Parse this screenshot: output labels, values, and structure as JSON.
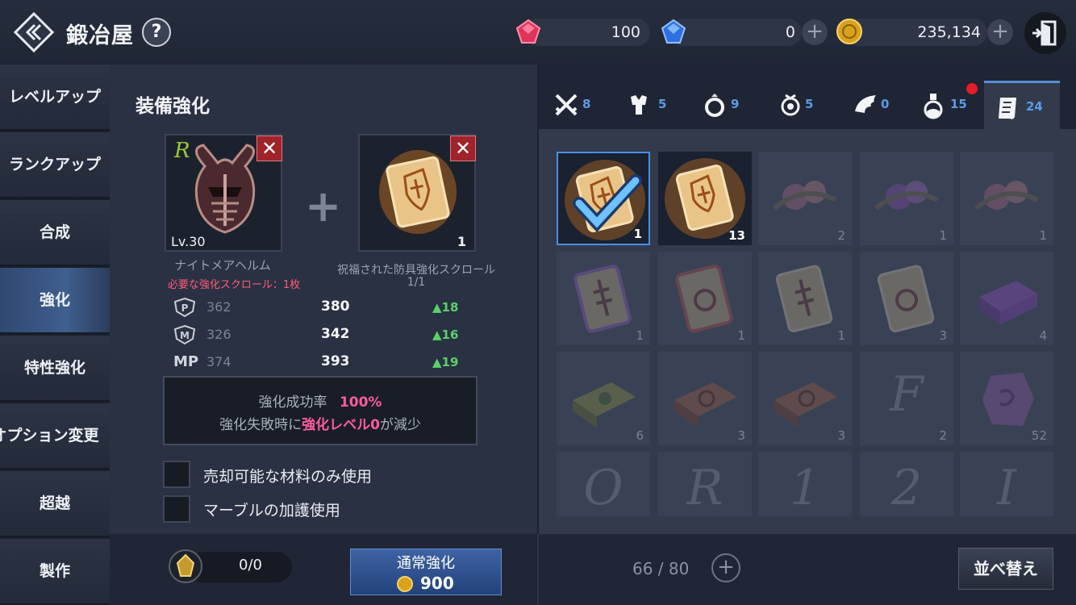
{
  "header": {
    "title": "鍛冶屋",
    "help": "?",
    "currencies": [
      {
        "icon": "red-gem-icon",
        "value": "100"
      },
      {
        "icon": "blue-gem-icon",
        "value": "0"
      },
      {
        "icon": "gold-coin-icon",
        "value": "235,134"
      }
    ]
  },
  "sidebar": {
    "items": [
      {
        "label": "レベルアップ",
        "active": false
      },
      {
        "label": "ランクアップ",
        "active": false
      },
      {
        "label": "合成",
        "active": false
      },
      {
        "label": "強化",
        "active": true
      },
      {
        "label": "特性強化",
        "active": false
      },
      {
        "label": "オプション変更",
        "active": false
      },
      {
        "label": "超越",
        "active": false
      },
      {
        "label": "製作",
        "active": false
      }
    ]
  },
  "enhance": {
    "title": "装備強化",
    "equipment": {
      "rank": "R",
      "level": "Lv.30",
      "name": "ナイトメアヘルム"
    },
    "required_note": "必要な強化スクロール：1枚",
    "material": {
      "count": "1",
      "name": "祝福された防具強化スクロール",
      "ratio": "1/1"
    },
    "stats": [
      {
        "icon": "physical-defense-icon",
        "old": "362",
        "new": "380",
        "diff": "▲18"
      },
      {
        "icon": "magic-defense-icon",
        "old": "326",
        "new": "342",
        "diff": "▲16"
      },
      {
        "label": "MP",
        "old": "374",
        "new": "393",
        "diff": "▲19"
      }
    ],
    "info": {
      "rate_label": "強化成功率",
      "rate_value": "100%",
      "fail_prefix": "強化失敗時に",
      "fail_highlight": "強化レベル0",
      "fail_suffix": "が減少"
    },
    "options": [
      {
        "label": "売却可能な材料のみ使用",
        "checked": false
      },
      {
        "label": "マーブルの加護使用",
        "checked": false
      }
    ]
  },
  "tabs": [
    {
      "icon": "crossed-swords-icon",
      "count": "8"
    },
    {
      "icon": "armor-icon",
      "count": "5"
    },
    {
      "icon": "ring-icon",
      "count": "9"
    },
    {
      "icon": "amulet-icon",
      "count": "5"
    },
    {
      "icon": "wing-icon",
      "count": "0"
    },
    {
      "icon": "potion-icon",
      "count": "15"
    },
    {
      "icon": "scroll-icon",
      "count": "24",
      "active": true
    }
  ],
  "inventory": [
    {
      "kind": "gold-scroll",
      "qty": "1",
      "state": "selected"
    },
    {
      "kind": "gold-scroll",
      "qty": "13",
      "state": "owned"
    },
    {
      "kind": "flower",
      "qty": "2",
      "state": "dim"
    },
    {
      "kind": "flower-purple",
      "qty": "1",
      "state": "dim"
    },
    {
      "kind": "flower",
      "qty": "1",
      "state": "dim"
    },
    {
      "kind": "rune-scroll-purple",
      "qty": "1",
      "state": "dim"
    },
    {
      "kind": "ring-scroll-red",
      "qty": "1",
      "state": "dim"
    },
    {
      "kind": "rune-scroll",
      "qty": "1",
      "state": "dim"
    },
    {
      "kind": "ring-scroll",
      "qty": "3",
      "state": "dim"
    },
    {
      "kind": "purple-box",
      "qty": "4",
      "state": "dim"
    },
    {
      "kind": "green-tablet",
      "qty": "6",
      "state": "dim"
    },
    {
      "kind": "red-tablet",
      "qty": "3",
      "state": "dim"
    },
    {
      "kind": "red-tablet",
      "qty": "3",
      "state": "dim"
    },
    {
      "kind": "letter",
      "letter": "F",
      "qty": "2",
      "state": "dim"
    },
    {
      "kind": "stone-purple",
      "qty": "52",
      "state": "dim"
    },
    {
      "kind": "letter",
      "letter": "O",
      "qty": "",
      "state": "dim"
    },
    {
      "kind": "letter",
      "letter": "R",
      "qty": "",
      "state": "dim"
    },
    {
      "kind": "letter",
      "letter": "1",
      "qty": "",
      "state": "dim"
    },
    {
      "kind": "letter",
      "letter": "2",
      "qty": "",
      "state": "dim"
    },
    {
      "kind": "letter",
      "letter": "I",
      "qty": "",
      "state": "dim"
    }
  ],
  "footer": {
    "stone_count": "0/0",
    "enhance_button": "通常強化",
    "enhance_cost": "900",
    "capacity": "66 / 80",
    "sort_button": "並べ替え"
  }
}
